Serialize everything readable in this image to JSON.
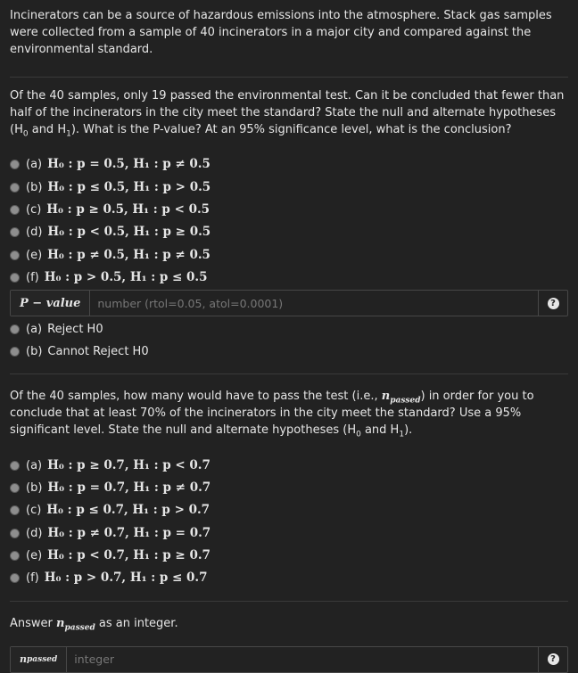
{
  "intro": "Incinerators can be a source of hazardous emissions into the atmosphere. Stack gas samples were collected from a sample of 40 incinerators in a major city and compared against the environmental standard.",
  "q1": {
    "prompt_a": "Of the 40 samples, only 19 passed the environmental test. Can it be concluded that fewer than half of the incinerators in the city meet the standard? State the null and alternate hypotheses (H",
    "sub0": "0",
    "mid": " and H",
    "sub1": "1",
    "prompt_b": "). What is the P-value? At an 95% significance level, what is the conclusion?",
    "options": [
      {
        "label": "(a)",
        "expr": "H₀ : p = 0.5,  H₁ : p ≠ 0.5"
      },
      {
        "label": "(b)",
        "expr": "H₀ : p ≤ 0.5,  H₁ : p > 0.5"
      },
      {
        "label": "(c)",
        "expr": "H₀ : p ≥ 0.5,  H₁ : p < 0.5"
      },
      {
        "label": "(d)",
        "expr": "H₀ : p < 0.5,  H₁ : p ≥ 0.5"
      },
      {
        "label": "(e)",
        "expr": "H₀ : p ≠ 0.5,  H₁ : p ≠ 0.5"
      },
      {
        "label": "(f)",
        "expr": "H₀ : p > 0.5,  H₁ : p ≤ 0.5"
      }
    ],
    "pvalue_addon": "P − value",
    "pvalue_placeholder": "number (rtol=0.05, atol=0.0001)",
    "help": "?",
    "conclusions": [
      {
        "label": "(a)",
        "text": "Reject H0"
      },
      {
        "label": "(b)",
        "text": "Cannot Reject H0"
      }
    ]
  },
  "q2": {
    "prompt_a": "Of the 40 samples, how many would have to pass the test (i.e., ",
    "np": "n",
    "np_sub": "passed",
    "prompt_b": ") in order for you to conclude that at least 70% of the incinerators in the city meet the standard? Use a 95% significant level. State the null and alternate hypotheses (H",
    "sub0": "0",
    "mid": " and H",
    "sub1": "1",
    "prompt_c": ").",
    "options": [
      {
        "label": "(a)",
        "expr": "H₀ : p ≥ 0.7,  H₁ : p < 0.7"
      },
      {
        "label": "(b)",
        "expr": "H₀ : p = 0.7,  H₁ : p ≠ 0.7"
      },
      {
        "label": "(c)",
        "expr": "H₀ : p ≤ 0.7,  H₁ : p > 0.7"
      },
      {
        "label": "(d)",
        "expr": "H₀ : p ≠ 0.7,  H₁ : p = 0.7"
      },
      {
        "label": "(e)",
        "expr": "H₀ : p < 0.7,  H₁ : p ≥ 0.7"
      },
      {
        "label": "(f)",
        "expr": "H₀ : p > 0.7,  H₁ : p ≤ 0.7"
      }
    ],
    "answer_a": "Answer ",
    "answer_b": " as an integer.",
    "addon_n": "n",
    "addon_sub": "passed",
    "placeholder": "integer",
    "help": "?"
  }
}
